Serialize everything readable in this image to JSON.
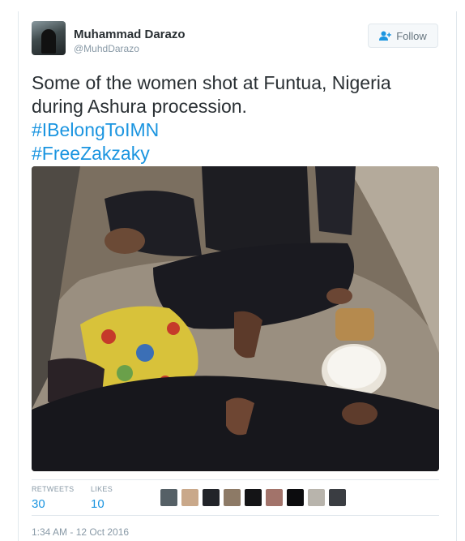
{
  "author": {
    "name": "Muhammad Darazo",
    "handle": "@MuhdDarazo"
  },
  "follow_button": {
    "label": "Follow",
    "icon": "add-user-icon"
  },
  "tweet": {
    "text_line1": "Some of the women shot at Funtua, Nigeria",
    "text_line2": "during Ashura procession.",
    "hashtags": [
      "#IBelongToIMN",
      "#FreeZakzaky"
    ]
  },
  "stats": {
    "retweets_label": "RETWEETS",
    "retweets_value": "30",
    "likes_label": "LIKES",
    "likes_value": "10"
  },
  "timestamp": "1:34 AM - 12 Oct 2016",
  "colors": {
    "link": "#1b95e0",
    "text": "#292f33",
    "muted": "#8899a6",
    "border": "#e1e8ed"
  }
}
